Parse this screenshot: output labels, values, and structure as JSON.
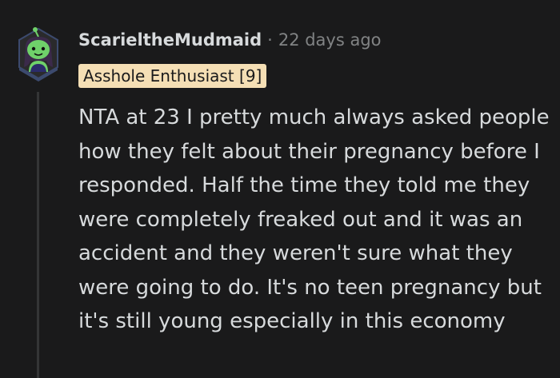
{
  "comment": {
    "username": "ScarieltheMudmaid",
    "separator": "·",
    "timestamp": "22 days ago",
    "flair": "Asshole Enthusiast [9]",
    "body": "NTA at 23 I pretty much always asked people how they felt about their pregnancy before I responded. Half the time they told me they were completely freaked out and it was an accident and they weren't sure what they were going to do. It's no teen pregnancy but it's still young especially in this economy"
  },
  "colors": {
    "background": "#1a1a1b",
    "text": "#d7dadc",
    "muted": "#818384",
    "flair_bg": "#f5dfb5",
    "thread_line": "#343536",
    "avatar_green": "#6fd16a"
  },
  "icons": {
    "avatar": "snoo-avatar-icon"
  }
}
